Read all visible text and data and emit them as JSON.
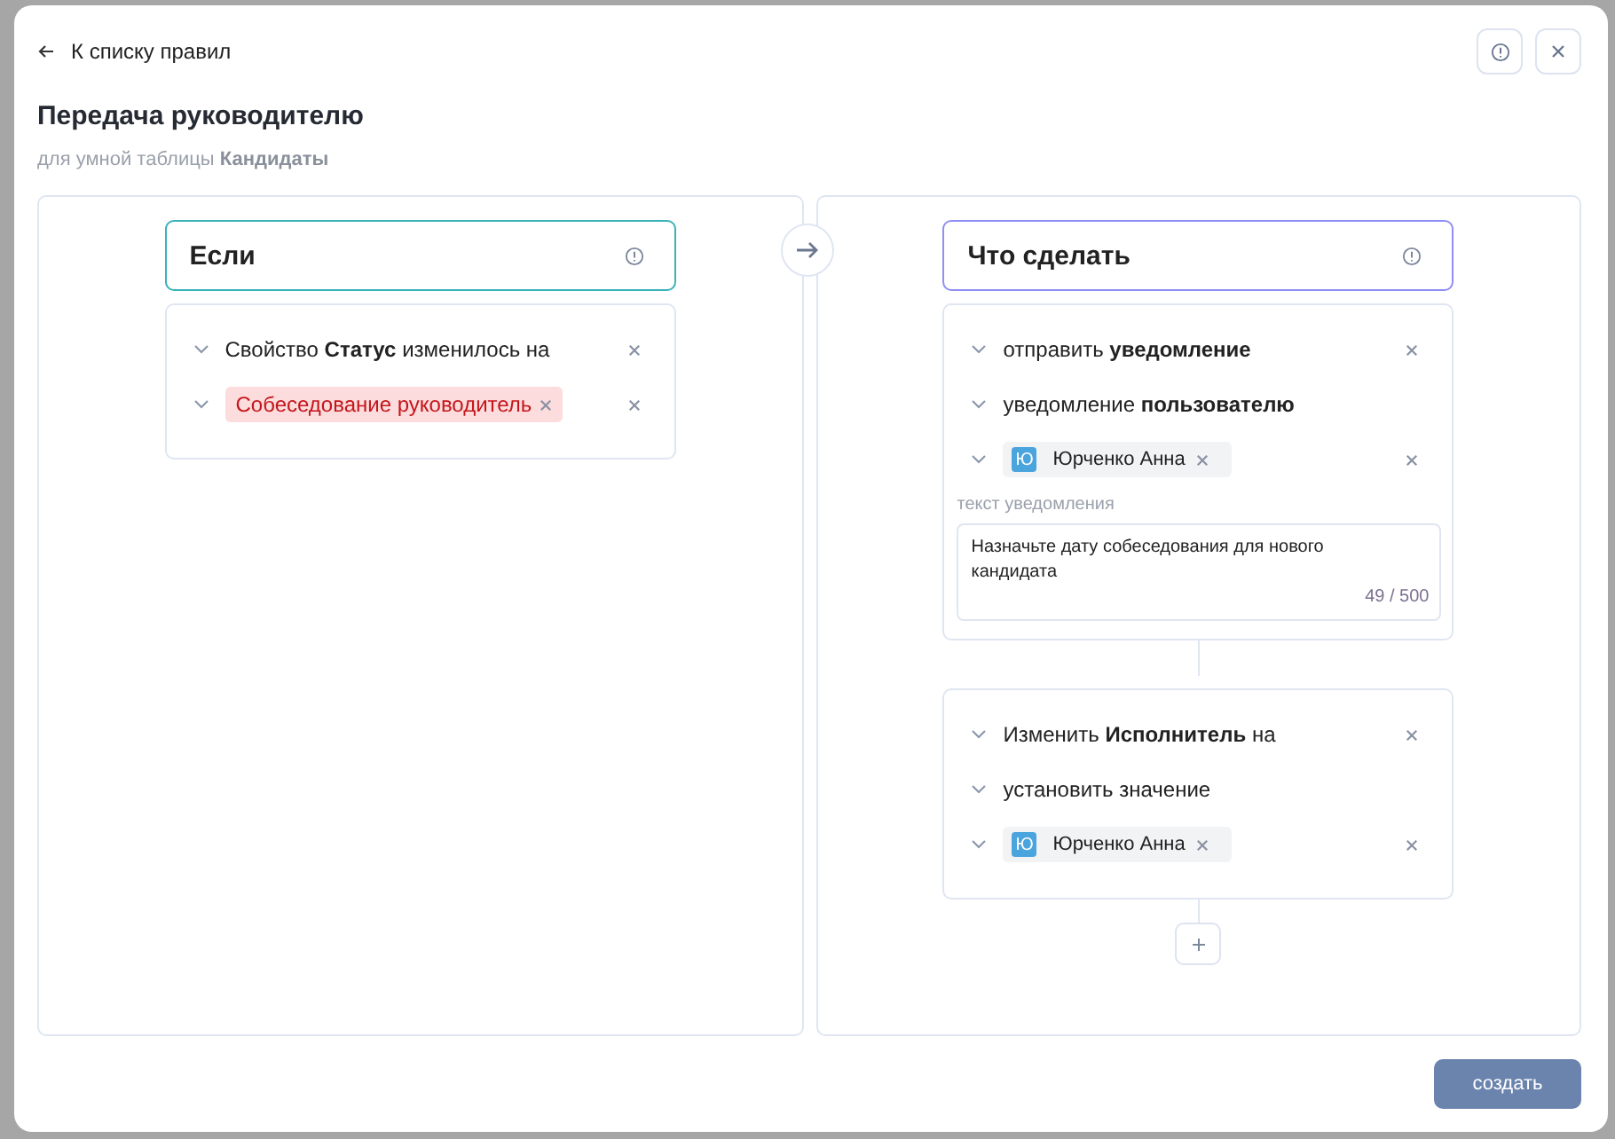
{
  "back_link": {
    "label": "К списку правил"
  },
  "title": "Передача руководителю",
  "subtitle": "для умной таблицы **Кандидаты**",
  "condition_panel": {
    "title": "Если",
    "rows": [
      {
        "kind": "text",
        "text": "Свойство **Статус** изменилось на",
        "removable": true
      },
      {
        "kind": "tag",
        "tag": "Собеседование руководитель",
        "removable": true
      }
    ]
  },
  "action_panel": {
    "title": "Что сделать",
    "actions": [
      {
        "rows": [
          {
            "kind": "text",
            "text": "отправить **уведомление**",
            "removable": true
          },
          {
            "kind": "text",
            "text": "уведомление **пользователю**",
            "removable": false
          },
          {
            "kind": "user",
            "initial": "Ю",
            "name": "Юрченко Анна",
            "removable": true
          },
          {
            "kind": "message",
            "label": "текст уведомления",
            "value": "Назначьте дату собеседования для нового кандидата",
            "counter": "49 / 500"
          }
        ]
      },
      {
        "rows": [
          {
            "kind": "text",
            "text": "Изменить **Исполнитель** на",
            "removable": true
          },
          {
            "kind": "text",
            "text": "установить значение",
            "removable": false
          },
          {
            "kind": "user",
            "initial": "Ю",
            "name": "Юрченко Анна",
            "removable": true
          }
        ]
      }
    ]
  },
  "submit_button": {
    "label": "создать"
  }
}
